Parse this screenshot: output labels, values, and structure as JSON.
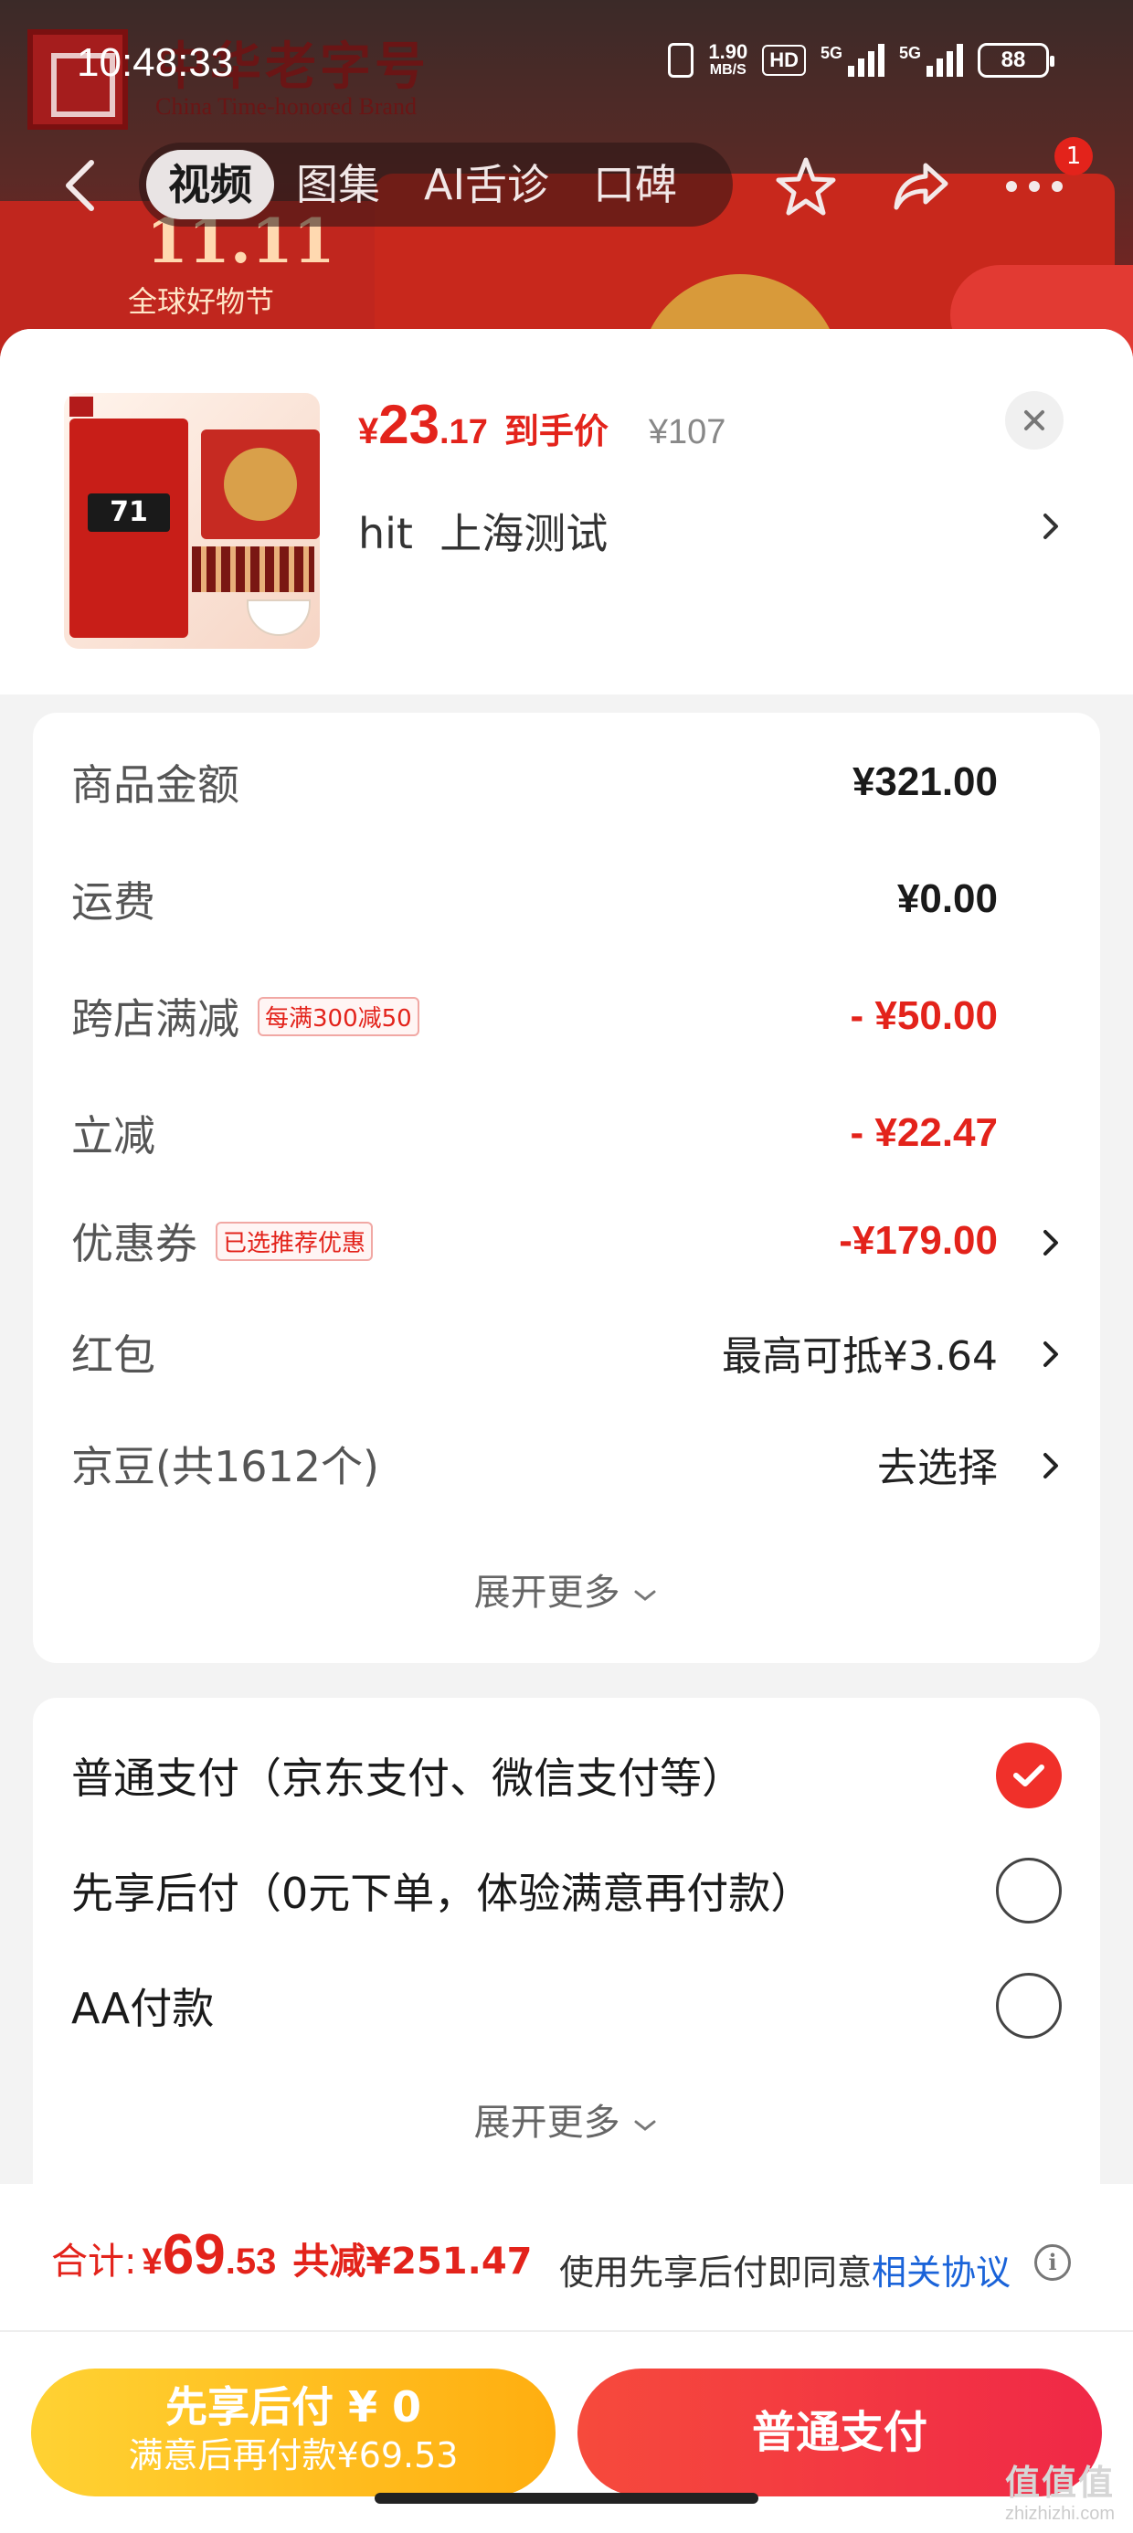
{
  "status_bar": {
    "time": "10:48:33",
    "speed_value": "1.90",
    "speed_unit": "MB/S",
    "hd_label": "HD",
    "signal1_label": "5G",
    "signal2_label": "5G",
    "battery": "88"
  },
  "background": {
    "brand_cn": "中华老字号",
    "brand_en": "China Time-honored Brand",
    "promo_1111": "11.11",
    "promo_sub": "全球好物节"
  },
  "nav": {
    "tabs": [
      {
        "label": "视频",
        "active": true
      },
      {
        "label": "图集",
        "active": false
      },
      {
        "label": "AI舌诊",
        "active": false
      },
      {
        "label": "口碑",
        "active": false
      }
    ],
    "notification_count": "1"
  },
  "product": {
    "thumb_price": "71",
    "price_symbol": "¥",
    "price_int": "23",
    "price_dec": ".17",
    "price_tip": "到手价",
    "original_price": "¥107",
    "spec": "hit  上海测试"
  },
  "summary": {
    "rows": [
      {
        "label": "商品金额",
        "value": "¥321.00"
      },
      {
        "label": "运费",
        "value": "¥0.00"
      },
      {
        "label": "跨店满减",
        "tag": "每满300减50",
        "value": "- ¥50.00"
      },
      {
        "label": "立减",
        "value": "- ¥22.47"
      },
      {
        "label": "优惠券",
        "tag": "已选推荐优惠",
        "value": "-¥179.00"
      },
      {
        "label": "红包",
        "value": "最高可抵¥3.64"
      },
      {
        "label": "京豆(共1612个)",
        "value": "去选择"
      }
    ],
    "expand_label": "展开更多"
  },
  "payment": {
    "options": [
      {
        "label": "普通支付（京东支付、微信支付等）",
        "selected": true
      },
      {
        "label": "先享后付（0元下单，体验满意再付款）",
        "selected": false
      },
      {
        "label": "AA付款",
        "selected": false
      }
    ],
    "expand_label": "展开更多"
  },
  "footer": {
    "total_label": "合计:",
    "total_symbol": "¥",
    "total_int": "69",
    "total_dec": ".53",
    "saved": "共减¥251.47",
    "agree_text": "使用先享后付即同意",
    "agree_link": "相关协议",
    "info_symbol": "i",
    "later_button_title": "先享后付 ¥ 0",
    "later_button_sub": "满意后再付款¥69.53",
    "pay_button": "普通支付"
  },
  "watermark": {
    "mark": "值值值",
    "site": "zhizhizhi.com"
  },
  "colors": {
    "accent_red": "#e3231b",
    "link_blue": "#1a63d9",
    "pay_later_yellow": "#ffae10"
  }
}
